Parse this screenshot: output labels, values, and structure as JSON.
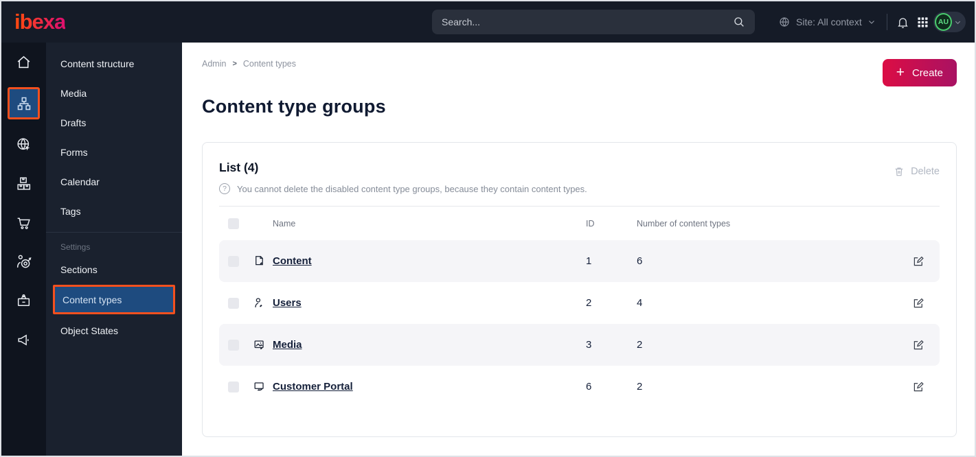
{
  "topbar": {
    "logo": "ibexa",
    "search_placeholder": "Search...",
    "site_selector": "Site: All context",
    "avatar_initials": "AU"
  },
  "sidebar": {
    "items": [
      {
        "label": "Content structure"
      },
      {
        "label": "Media"
      },
      {
        "label": "Drafts"
      },
      {
        "label": "Forms"
      },
      {
        "label": "Calendar"
      },
      {
        "label": "Tags"
      }
    ],
    "settings_label": "Settings",
    "settings_items": [
      {
        "label": "Sections"
      },
      {
        "label": "Content types"
      },
      {
        "label": "Object States"
      }
    ]
  },
  "main": {
    "breadcrumb": {
      "0": "Admin",
      "1": "Content types"
    },
    "create_label": "Create",
    "title": "Content type groups",
    "card": {
      "list_title": "List (4)",
      "info_text": "You cannot delete the disabled content type groups, because they contain content types.",
      "delete_label": "Delete",
      "table": {
        "columns": {
          "0": "Name",
          "1": "ID",
          "2": "Number of content types"
        },
        "rows": [
          {
            "name": "Content",
            "id": "1",
            "count": "6"
          },
          {
            "name": "Users",
            "id": "2",
            "count": "4"
          },
          {
            "name": "Media",
            "id": "3",
            "count": "2"
          },
          {
            "name": "Customer Portal",
            "id": "6",
            "count": "2"
          }
        ]
      }
    }
  },
  "colors": {
    "topbar_bg": "#151b27",
    "rail_bg": "#0f141e",
    "subnav_bg": "#1a212e",
    "selected_blue": "#1e4b7f",
    "highlight_orange": "#f4501e",
    "create_gradient_start": "#dc0d44",
    "create_gradient_end": "#a81263",
    "avatar_green": "#49cc6d",
    "row_alt_bg": "#f5f5f8"
  }
}
